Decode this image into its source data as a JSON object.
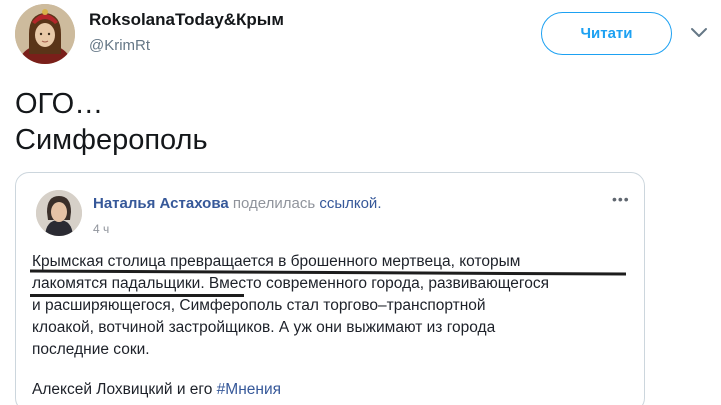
{
  "user": {
    "display_name": "RoksolanaToday&Крым",
    "handle": "@KrimRt"
  },
  "follow_label": "Читати",
  "tweet_text": [
    "ОГО…",
    "Симферополь"
  ],
  "fb_post": {
    "author": "Наталья Астахова",
    "action": "поделилась",
    "link_text": "ссылкой.",
    "time": "4 ч",
    "more": "•••",
    "body_lines": [
      "Крымская столица превращается в брошенного мертвеца, которым",
      "лакомятся падальщики. Вместо современного города, развивающегося",
      "и расширяющегося, Симферополь стал торгово–транспортной",
      "клоакой, вотчиной застройщиков. А уж они выжимают из города",
      "последние соки."
    ],
    "footer_text": "Алексей Лохвицкий и его",
    "footer_hashtag": "#Мнения"
  },
  "colors": {
    "twitter_blue": "#1da1f2",
    "facebook_link": "#365899",
    "muted": "#657786"
  }
}
